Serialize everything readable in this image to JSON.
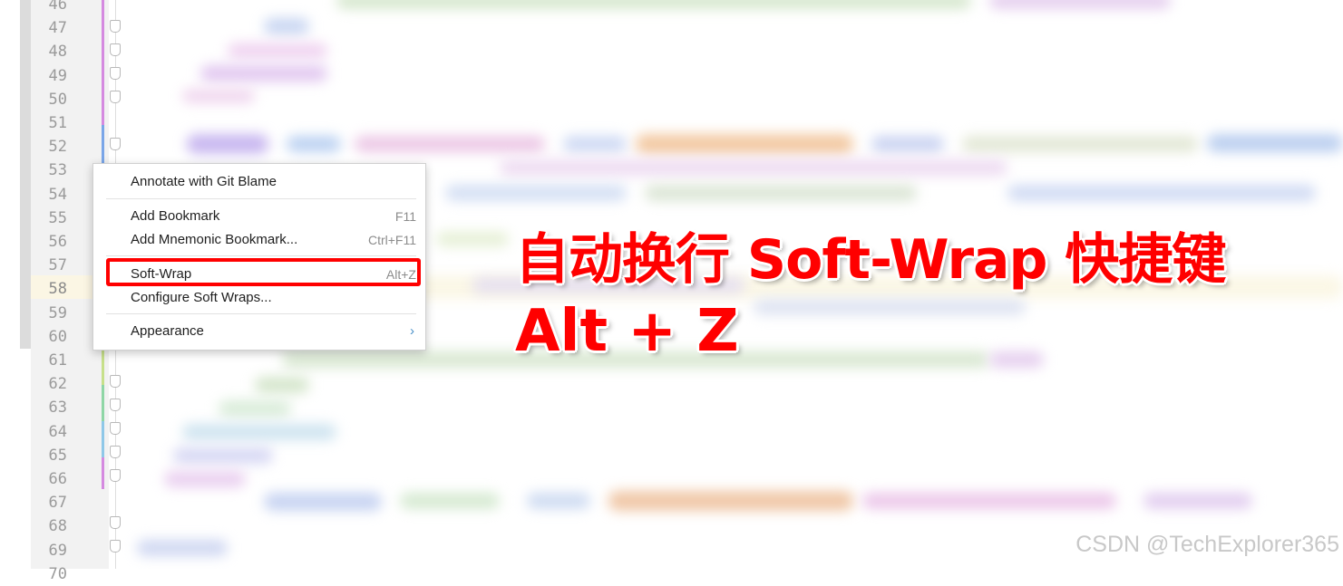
{
  "editor": {
    "line_numbers": [
      "46",
      "47",
      "48",
      "49",
      "50",
      "51",
      "52",
      "53",
      "54",
      "55",
      "56",
      "57",
      "58",
      "59",
      "60",
      "61",
      "62",
      "63",
      "64",
      "65",
      "66",
      "67",
      "68",
      "69",
      "70"
    ],
    "current_line": "58"
  },
  "context_menu": {
    "annotate": {
      "label": "Annotate with Git Blame"
    },
    "add_bookmark": {
      "label": "Add Bookmark",
      "shortcut": "F11"
    },
    "add_mnemonic_bookmark": {
      "label": "Add Mnemonic Bookmark...",
      "shortcut": "Ctrl+F11"
    },
    "soft_wrap": {
      "label": "Soft-Wrap",
      "shortcut": "Alt+Z"
    },
    "configure_soft_wraps": {
      "label": "Configure Soft Wraps..."
    },
    "appearance": {
      "label": "Appearance",
      "arrow": "›"
    }
  },
  "overlay": {
    "headline": "自动换行 Soft-Wrap 快捷键",
    "shortcut_text": "Alt + Z",
    "color": "#ff0000"
  },
  "watermark": "CSDN @TechExplorer365"
}
